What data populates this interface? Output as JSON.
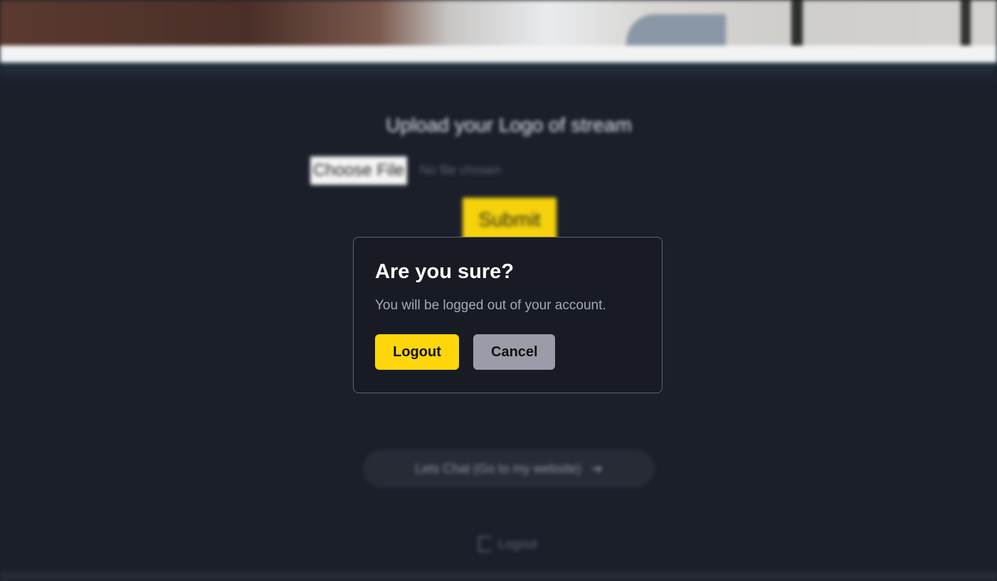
{
  "background": {
    "upload_title": "Upload your Logo of stream",
    "choose_file_label": "Choose File",
    "no_file_text": "No file chosen",
    "submit_label": "Submit",
    "chat_link_label": "Lets Chat (Go to my website)",
    "chat_link_icon": "arrow-right-icon",
    "logout_link_label": "Logout",
    "logout_link_icon": "logout-icon"
  },
  "modal": {
    "title": "Are you sure?",
    "message": "You will be logged out of your account.",
    "confirm_label": "Logout",
    "cancel_label": "Cancel"
  },
  "colors": {
    "page_background": "#1b1f2a",
    "accent_yellow": "#ffd60a",
    "cancel_gray": "#9a9da9",
    "modal_background": "#181b24"
  }
}
